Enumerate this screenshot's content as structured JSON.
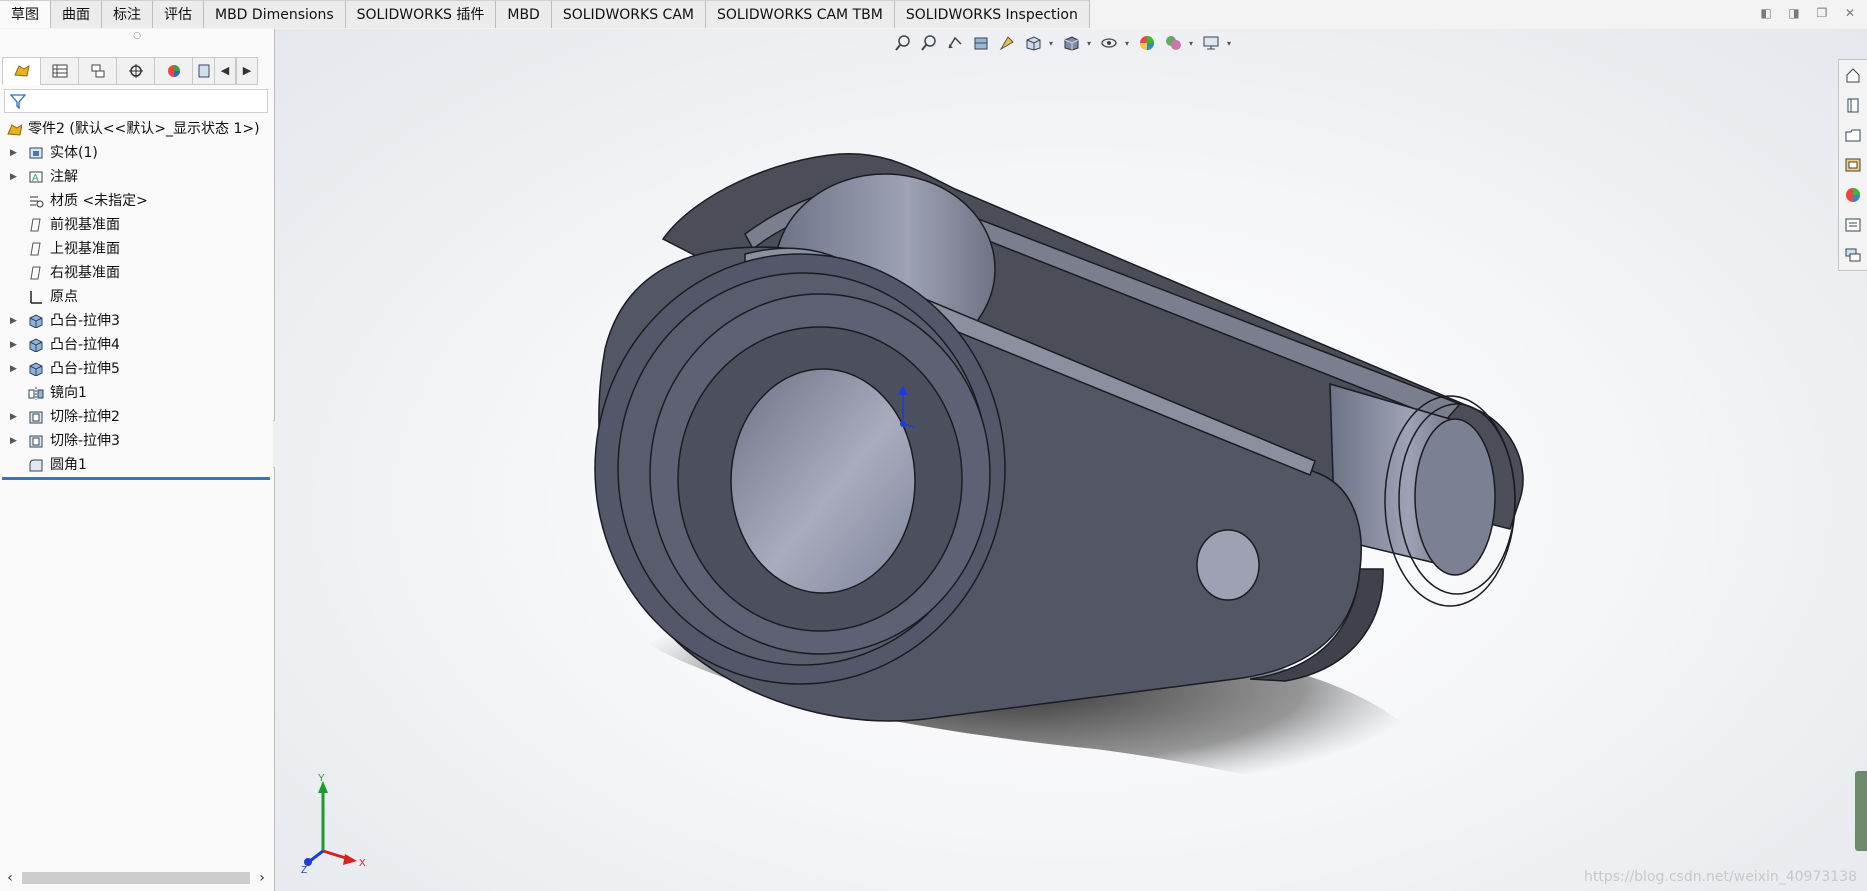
{
  "command_tabs": [
    {
      "label": "草图",
      "active": true
    },
    {
      "label": "曲面",
      "active": false
    },
    {
      "label": "标注",
      "active": false
    },
    {
      "label": "评估",
      "active": false
    },
    {
      "label": "MBD Dimensions",
      "active": false
    },
    {
      "label": "SOLIDWORKS 插件",
      "active": false
    },
    {
      "label": "MBD",
      "active": false
    },
    {
      "label": "SOLIDWORKS CAM",
      "active": false
    },
    {
      "label": "SOLIDWORKS CAM TBM",
      "active": false
    },
    {
      "label": "SOLIDWORKS Inspection",
      "active": false
    }
  ],
  "feature_tree": {
    "root": "零件2 (默认<<默认>_显示状态 1>)",
    "items": [
      {
        "label": "实体(1)",
        "icon": "solid-bodies-icon",
        "expandable": true
      },
      {
        "label": "注解",
        "icon": "annotations-icon",
        "expandable": true
      },
      {
        "label": "材质 <未指定>",
        "icon": "material-icon",
        "expandable": false
      },
      {
        "label": "前视基准面",
        "icon": "plane-icon",
        "expandable": false
      },
      {
        "label": "上视基准面",
        "icon": "plane-icon",
        "expandable": false
      },
      {
        "label": "右视基准面",
        "icon": "plane-icon",
        "expandable": false
      },
      {
        "label": "原点",
        "icon": "origin-icon",
        "expandable": false
      },
      {
        "label": "凸台-拉伸3",
        "icon": "boss-extrude-icon",
        "expandable": true
      },
      {
        "label": "凸台-拉伸4",
        "icon": "boss-extrude-icon",
        "expandable": true
      },
      {
        "label": "凸台-拉伸5",
        "icon": "boss-extrude-icon",
        "expandable": true
      },
      {
        "label": "镜向1",
        "icon": "mirror-icon",
        "expandable": false
      },
      {
        "label": "切除-拉伸2",
        "icon": "cut-extrude-icon",
        "expandable": true
      },
      {
        "label": "切除-拉伸3",
        "icon": "cut-extrude-icon",
        "expandable": true
      },
      {
        "label": "圆角1",
        "icon": "fillet-icon",
        "expandable": false
      }
    ]
  },
  "triad": {
    "x": "X",
    "y": "Y",
    "z": "Z"
  },
  "watermark": "https://blog.csdn.net/weixin_40973138",
  "colors": {
    "model": "#5a5d6b",
    "model_light": "#8e93a6",
    "rollback_bar": "#2f79c4"
  }
}
